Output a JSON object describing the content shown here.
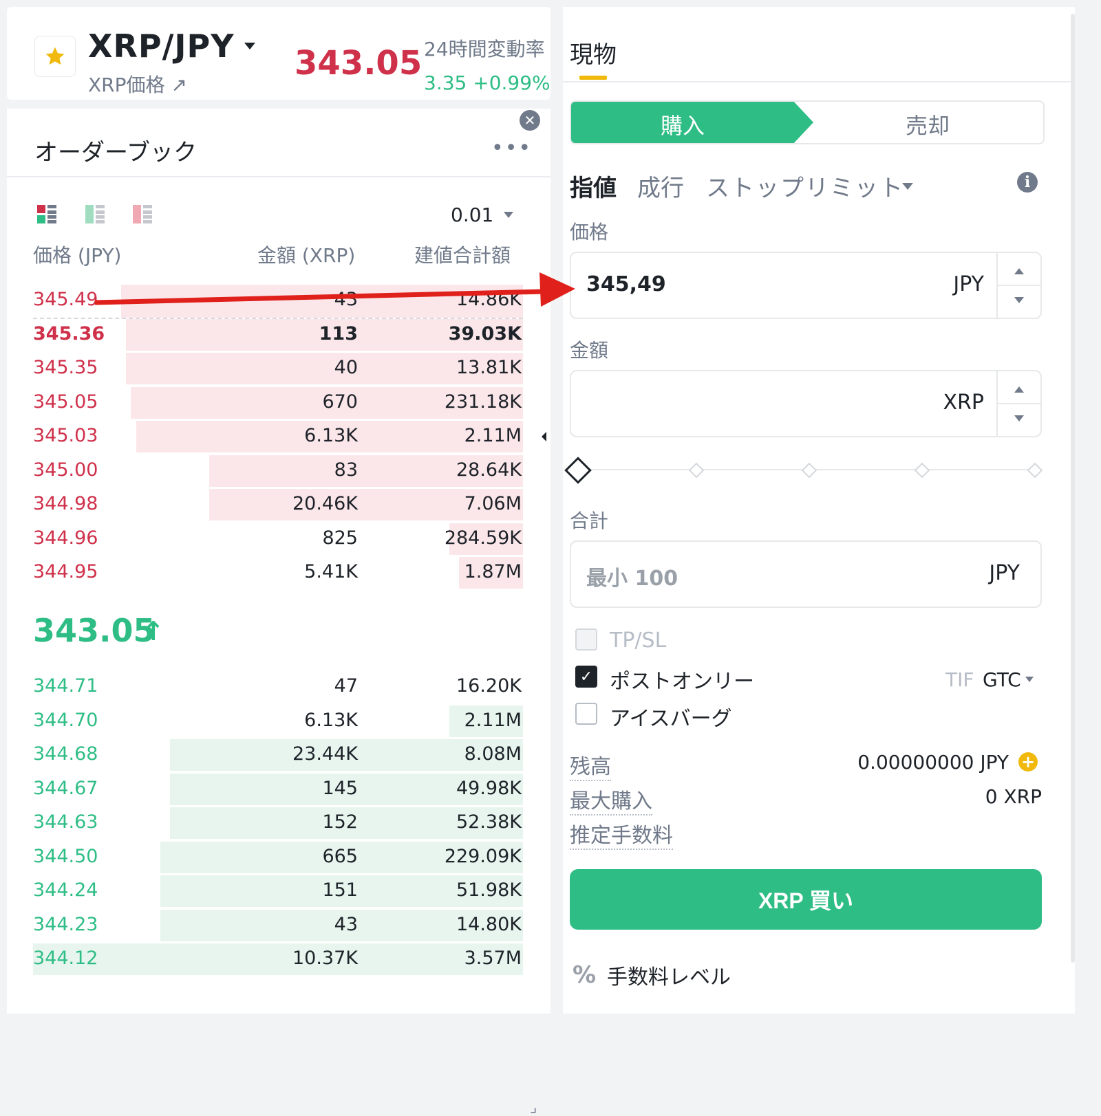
{
  "header": {
    "pair": "XRP/JPY",
    "pair_sub": "XRP価格 ↗",
    "last_price": "343.05",
    "change_label": "24時間変動率",
    "change_value": "3.35 +0.99%"
  },
  "orderbook": {
    "title": "オーダーブック",
    "more": "•••",
    "close": "✕",
    "precision": "0.01",
    "columns": {
      "price": "価格 (JPY)",
      "amount": "金額 (XRP)",
      "total": "建値合計額"
    },
    "asks": [
      {
        "price": "345.49",
        "amount": "43",
        "total": "14.86K",
        "depth": 0.82,
        "bold": false
      },
      {
        "price": "345.36",
        "amount": "113",
        "total": "39.03K",
        "depth": 0.81,
        "bold": true
      },
      {
        "price": "345.35",
        "amount": "40",
        "total": "13.81K",
        "depth": 0.81,
        "bold": false
      },
      {
        "price": "345.05",
        "amount": "670",
        "total": "231.18K",
        "depth": 0.8,
        "bold": false
      },
      {
        "price": "345.03",
        "amount": "6.13K",
        "total": "2.11M",
        "depth": 0.79,
        "bold": false
      },
      {
        "price": "345.00",
        "amount": "83",
        "total": "28.64K",
        "depth": 0.64,
        "bold": false
      },
      {
        "price": "344.98",
        "amount": "20.46K",
        "total": "7.06M",
        "depth": 0.64,
        "bold": false
      },
      {
        "price": "344.96",
        "amount": "825",
        "total": "284.59K",
        "depth": 0.15,
        "bold": false
      },
      {
        "price": "344.95",
        "amount": "5.41K",
        "total": "1.87M",
        "depth": 0.13,
        "bold": false
      }
    ],
    "mid_price": "343.05",
    "mid_arrow": "↑",
    "bids": [
      {
        "price": "344.71",
        "amount": "47",
        "total": "16.20K",
        "depth": 0.0
      },
      {
        "price": "344.70",
        "amount": "6.13K",
        "total": "2.11M",
        "depth": 0.15
      },
      {
        "price": "344.68",
        "amount": "23.44K",
        "total": "8.08M",
        "depth": 0.72
      },
      {
        "price": "344.67",
        "amount": "145",
        "total": "49.98K",
        "depth": 0.72
      },
      {
        "price": "344.63",
        "amount": "152",
        "total": "52.38K",
        "depth": 0.72
      },
      {
        "price": "344.50",
        "amount": "665",
        "total": "229.09K",
        "depth": 0.74
      },
      {
        "price": "344.24",
        "amount": "151",
        "total": "51.98K",
        "depth": 0.74
      },
      {
        "price": "344.23",
        "amount": "43",
        "total": "14.80K",
        "depth": 0.74
      },
      {
        "price": "344.12",
        "amount": "10.37K",
        "total": "3.57M",
        "depth": 1.0
      }
    ]
  },
  "trade": {
    "tab_spot": "現物",
    "buy_tab": "購入",
    "sell_tab": "売却",
    "order_types": {
      "limit": "指値",
      "market": "成行",
      "stop": "ストップリミット"
    },
    "price_label": "価格",
    "price_value": "345,49",
    "price_unit": "JPY",
    "amount_label": "金額",
    "amount_value": "",
    "amount_unit": "XRP",
    "total_label": "合計",
    "total_placeholder": "最小 100",
    "total_unit": "JPY",
    "tpsl": "TP/SL",
    "post_only": "ポストオンリー",
    "iceberg": "アイスバーグ",
    "tif_label": "TIF",
    "tif_value": "GTC",
    "balance_label": "残高",
    "balance_value": "0.00000000 JPY",
    "max_buy_label": "最大購入",
    "max_buy_value": "0 XRP",
    "est_fee_label": "推定手数料",
    "buy_button": "XRP 買い",
    "fee_level": "手数料レベル"
  },
  "colors": {
    "ask": "#cf304a",
    "bid": "#2ebd85",
    "accent": "#f0b90b",
    "arrow": "#e0201b"
  }
}
